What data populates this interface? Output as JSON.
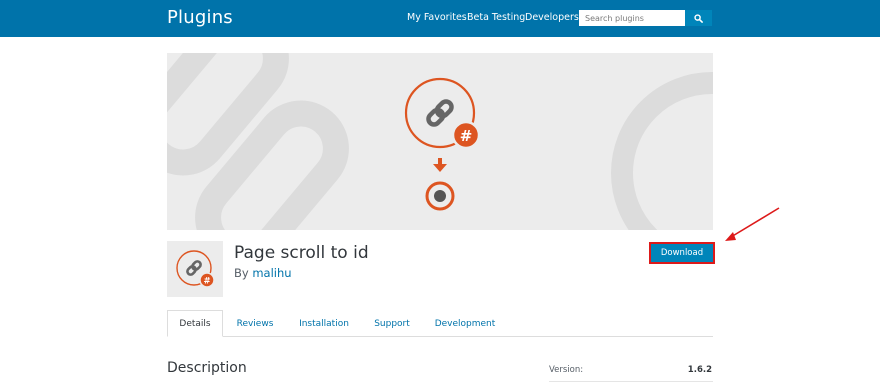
{
  "header": {
    "title": "Plugins",
    "nav": [
      "My Favorites",
      "Beta Testing",
      "Developers"
    ],
    "search_placeholder": "Search plugins"
  },
  "plugin": {
    "name": "Page scroll to id",
    "author_prefix": "By",
    "author": "malihu",
    "download_label": "Download"
  },
  "tabs": [
    "Details",
    "Reviews",
    "Installation",
    "Support",
    "Development"
  ],
  "active_tab": "Details",
  "description": {
    "heading": "Description"
  },
  "meta": {
    "version_label": "Version:",
    "version_value": "1.6.2"
  },
  "colors": {
    "brand_blue": "#0073aa",
    "button_blue": "#0085ba",
    "accent_orange": "#dd5521",
    "highlight_red": "#dd1a1a"
  },
  "icons": {
    "search": "search-icon",
    "link": "link-icon",
    "hash": "hash-icon",
    "arrow_down": "arrow-down-icon",
    "target": "target-icon"
  }
}
